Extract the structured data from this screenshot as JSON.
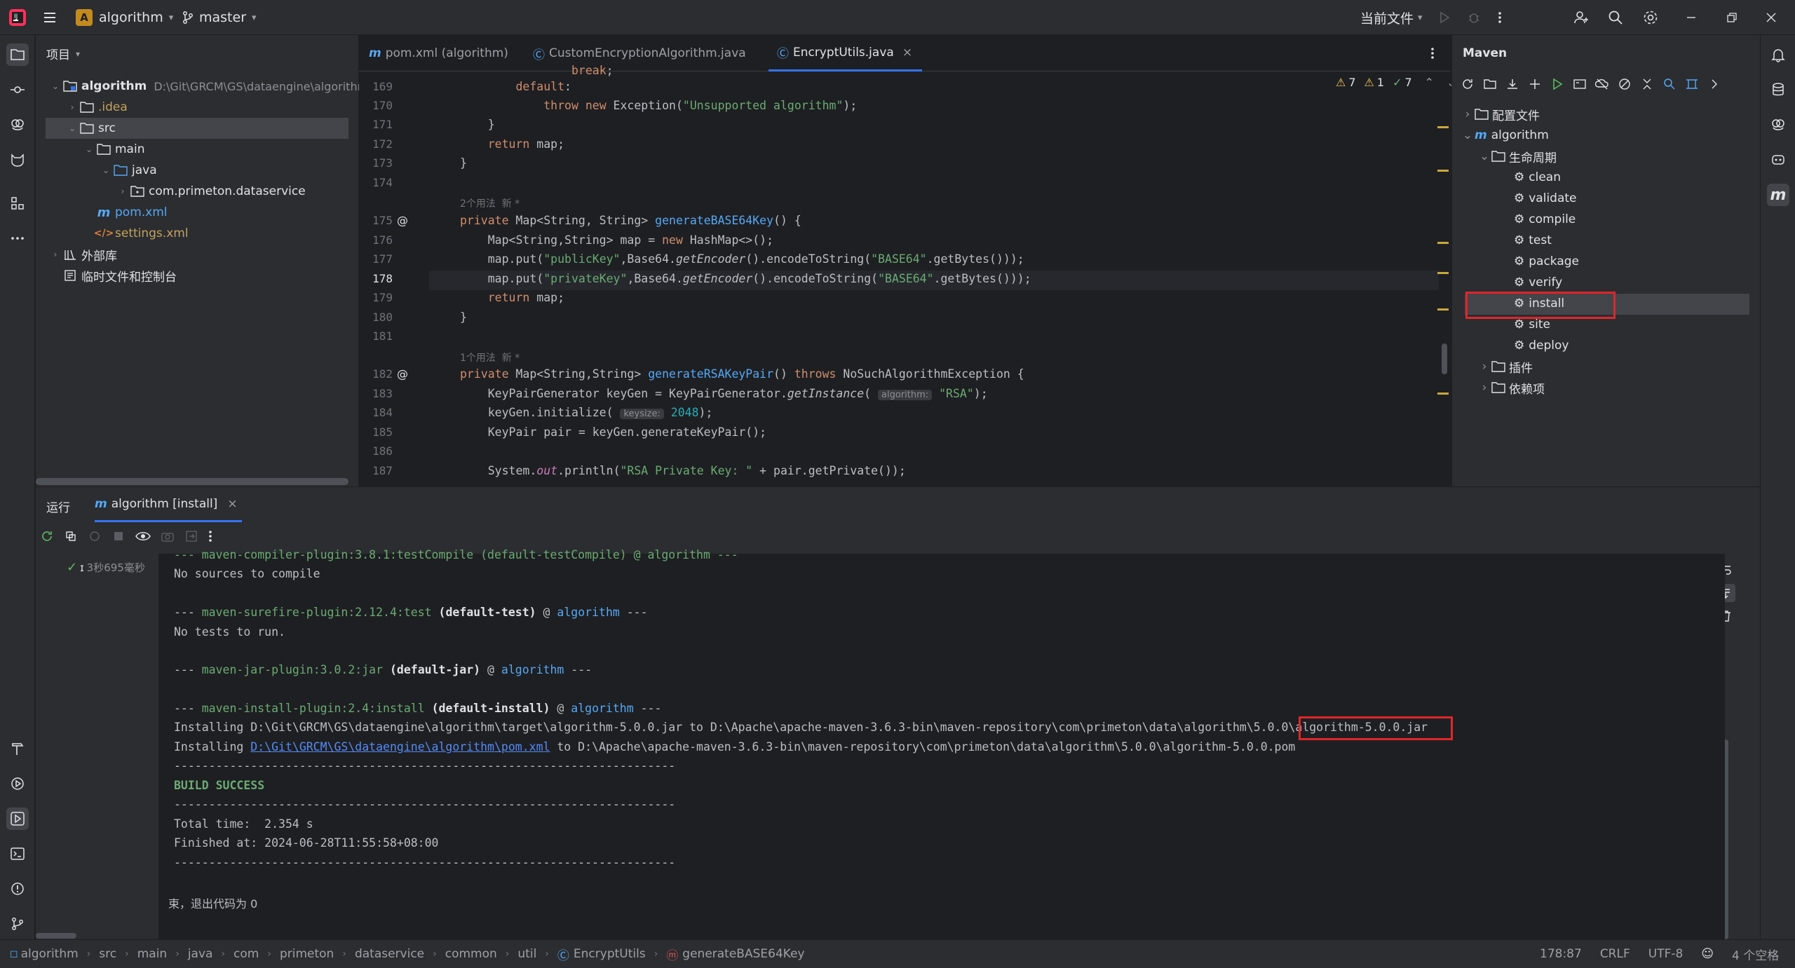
{
  "titlebar": {
    "project_badge": "A",
    "project_name": "algorithm",
    "branch": "master",
    "run_config": "当前文件"
  },
  "project_panel": {
    "title": "项目",
    "items": [
      {
        "label": "algorithm",
        "path": "D:\\Git\\GRCM\\GS\\dataengine\\algorithm"
      },
      {
        "label": ".idea"
      },
      {
        "label": "src"
      },
      {
        "label": "main"
      },
      {
        "label": "java"
      },
      {
        "label": "com.primeton.dataservice"
      },
      {
        "label": "pom.xml"
      },
      {
        "label": "settings.xml"
      },
      {
        "label": "外部库"
      },
      {
        "label": "临时文件和控制台"
      }
    ]
  },
  "editor": {
    "tabs": [
      {
        "label": "pom.xml (algorithm)"
      },
      {
        "label": "CustomEncryptionAlgorithm.java"
      },
      {
        "label": "EncryptUtils.java"
      }
    ],
    "inspections": {
      "warnings": "7",
      "weak": "1",
      "ok": "7"
    },
    "line_numbers": [
      "169",
      "170",
      "171",
      "172",
      "173",
      "174",
      "175",
      "176",
      "177",
      "178",
      "179",
      "180",
      "181",
      "182",
      "183",
      "184",
      "185",
      "186",
      "187"
    ],
    "usage_hints": [
      "2个用法  新 *",
      "1个用法  新 *"
    ],
    "current_line": "178"
  },
  "maven": {
    "title": "Maven",
    "items": [
      {
        "label": "配置文件"
      },
      {
        "label": "algorithm"
      },
      {
        "label": "生命周期"
      },
      {
        "label": "clean"
      },
      {
        "label": "validate"
      },
      {
        "label": "compile"
      },
      {
        "label": "test"
      },
      {
        "label": "package"
      },
      {
        "label": "verify"
      },
      {
        "label": "install"
      },
      {
        "label": "site"
      },
      {
        "label": "deploy"
      },
      {
        "label": "插件"
      },
      {
        "label": "依赖项"
      }
    ]
  },
  "run": {
    "tab_run": "运行",
    "tab_config": "algorithm [install]",
    "duration": "3秒695毫秒",
    "console": {
      "l0": "--- maven-compiler-plugin:3.8.1:testCompile (default-testCompile) @ algorithm ---",
      "l1": "No sources to compile",
      "l2a": "--- ",
      "l2b": "maven-surefire-plugin:2.12.4:test",
      "l2c": " (default-test)",
      "l2d": " @ ",
      "l2e": "algorithm",
      "l2f": " ---",
      "l3": "No tests to run.",
      "l4a": "--- ",
      "l4b": "maven-jar-plugin:3.0.2:jar",
      "l4c": " (default-jar)",
      "l4d": " @ ",
      "l4e": "algorithm",
      "l4f": " ---",
      "l5a": "--- ",
      "l5b": "maven-install-plugin:2.4:install",
      "l5c": " (default-install)",
      "l5d": " @ ",
      "l5e": "algorithm",
      "l5f": " ---",
      "l6a": "Installing D:\\Git\\GRCM\\GS\\dataengine\\algorithm\\target\\algorithm-5.0.0.jar to D:\\Apache\\apache-maven-3.6.3-bin\\maven-repository\\com\\primeton\\data\\algorithm\\5.0.0\\",
      "l6b": "algorithm-5.0.0.jar",
      "l7a": "Installing ",
      "l7b": "D:\\Git\\GRCM\\GS\\dataengine\\algorithm\\pom.xml",
      "l7c": " to D:\\Apache\\apache-maven-3.6.3-bin\\maven-repository\\com\\primeton\\data\\algorithm\\5.0.0\\algorithm-5.0.0.pom",
      "dash": "------------------------------------------------------------------------",
      "success": "BUILD SUCCESS",
      "total": "Total time:  2.354 s",
      "finished": "Finished at: 2024-06-28T11:55:58+08:00",
      "exit": "束，退出代码为 0"
    }
  },
  "status": {
    "breadcrumbs": [
      "algorithm",
      "src",
      "main",
      "java",
      "com",
      "primeton",
      "dataservice",
      "common",
      "util",
      "EncryptUtils",
      "generateBASE64Key"
    ],
    "position": "178:87",
    "line_sep": "CRLF",
    "encoding": "UTF-8",
    "indent": "4 个空格"
  }
}
